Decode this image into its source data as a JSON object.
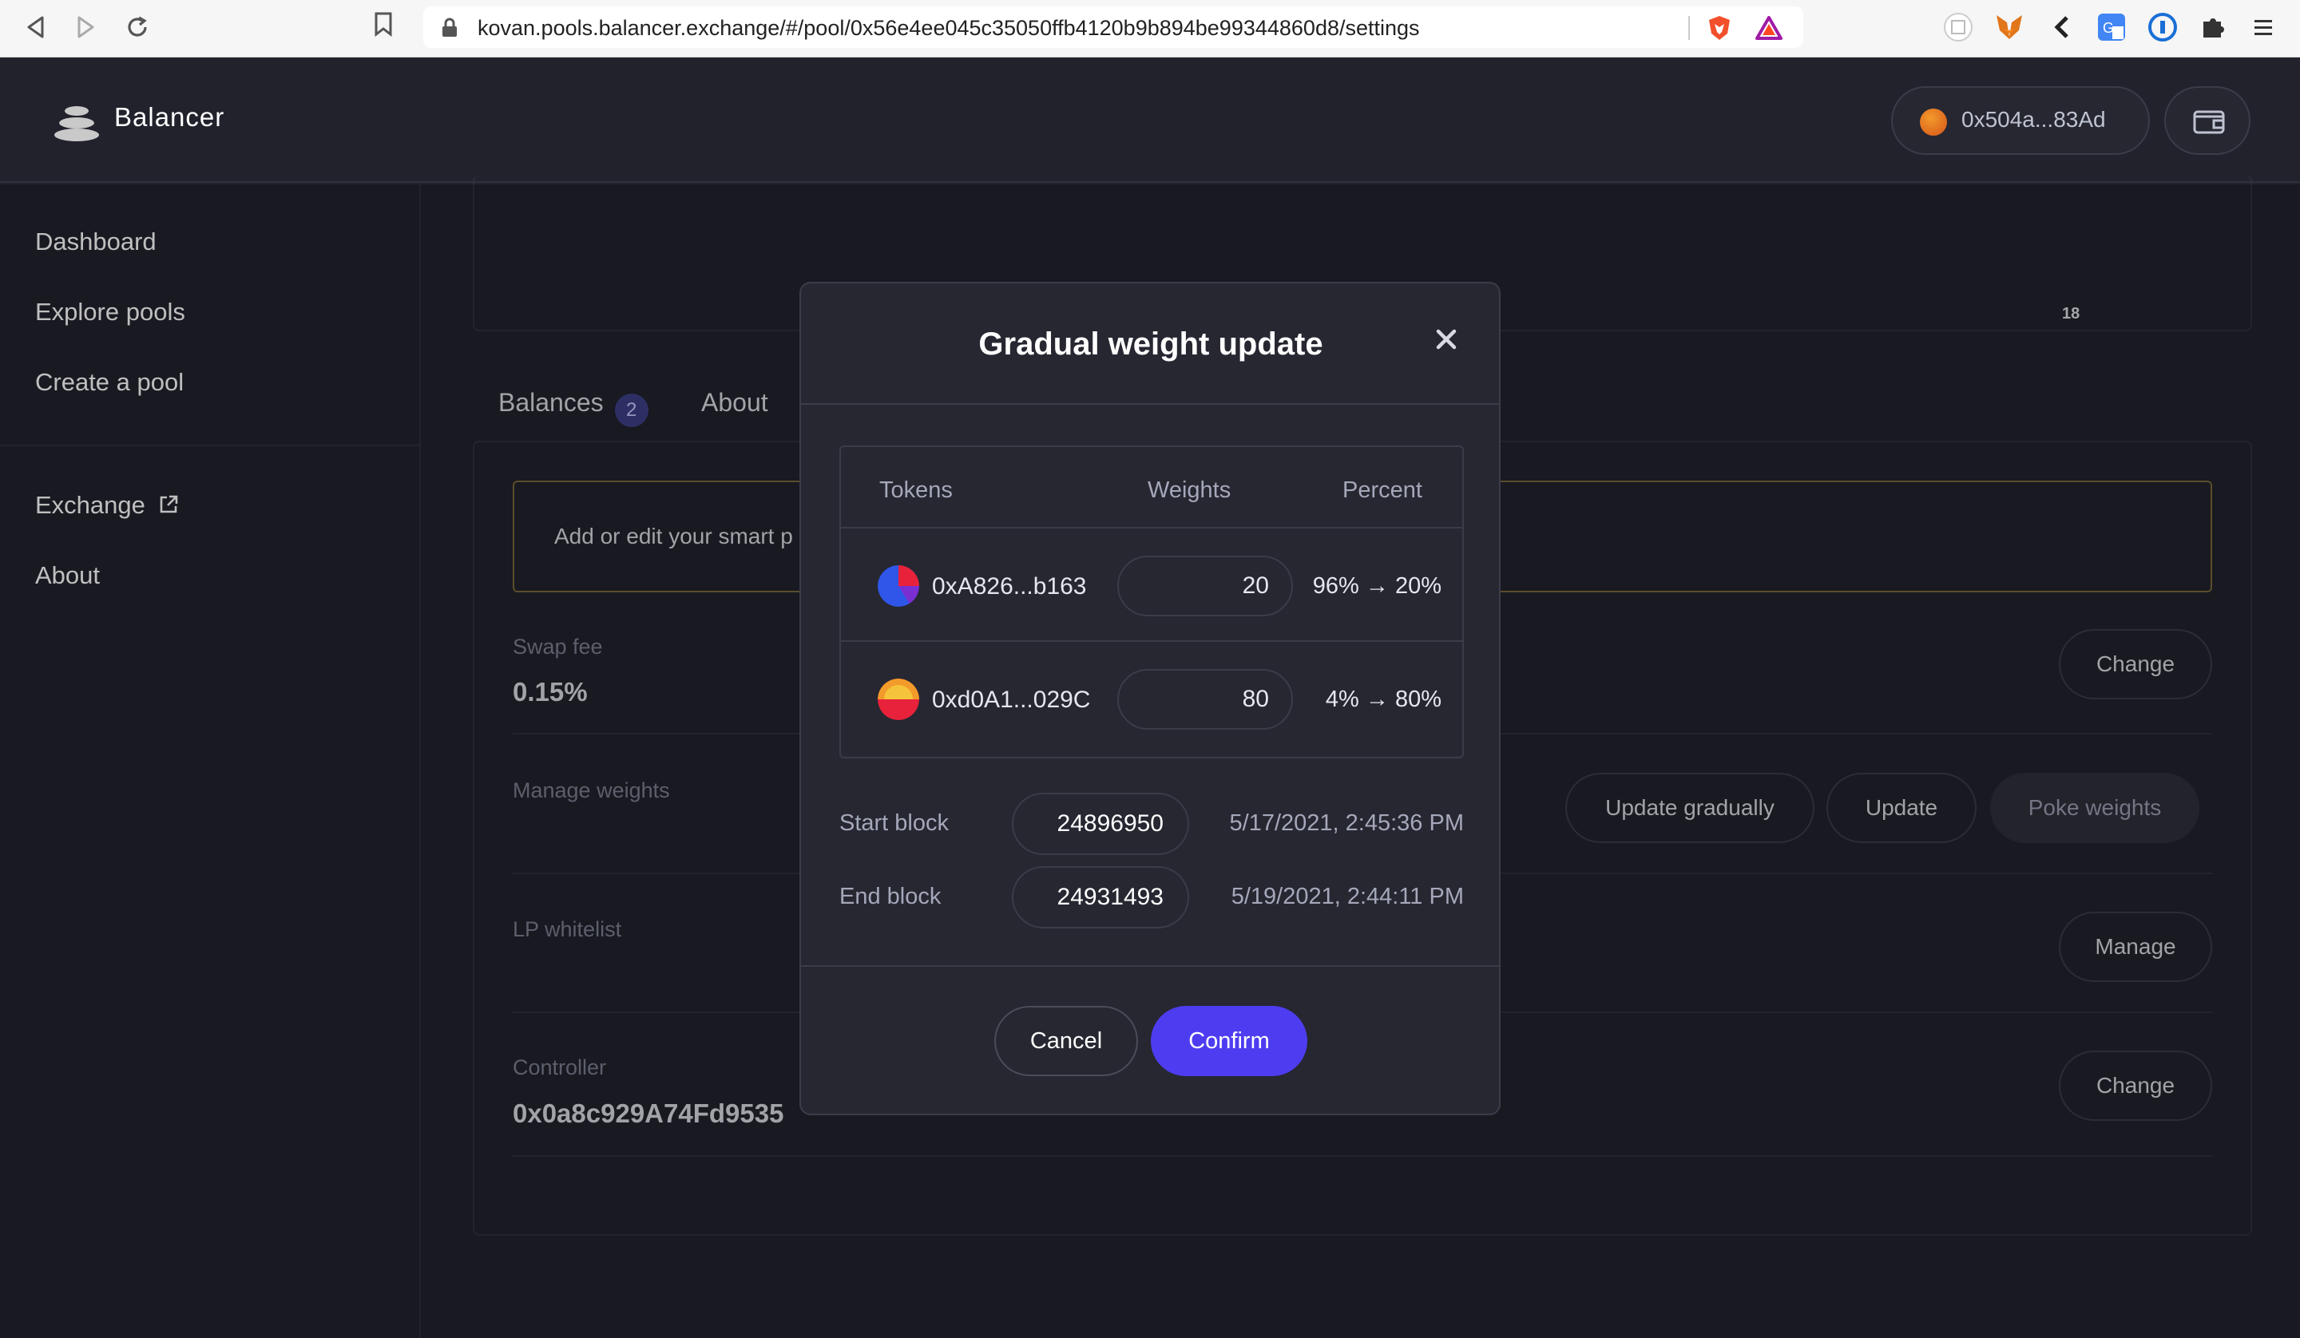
{
  "browser": {
    "url": "kovan.pools.balancer.exchange/#/pool/0x56e4ee045c35050ffb4120b9b894be99344860d8/settings"
  },
  "header": {
    "brand": "Balancer",
    "account": "0x504a...83Ad"
  },
  "sidebar": {
    "items": [
      {
        "label": "Dashboard"
      },
      {
        "label": "Explore pools"
      },
      {
        "label": "Create a pool"
      },
      {
        "label": "Exchange"
      },
      {
        "label": "About"
      }
    ]
  },
  "chart": {
    "tick": "18"
  },
  "tabs": {
    "balances": "Balances",
    "balances_count": "2",
    "about": "About"
  },
  "settings": {
    "notice": "Add or edit your smart p",
    "swap_fee_label": "Swap fee",
    "swap_fee_value": "0.15%",
    "swap_fee_button": "Change",
    "manage_weights_label": "Manage weights",
    "update_gradually_button": "Update gradually",
    "update_button": "Update",
    "poke_weights_button": "Poke weights",
    "lp_whitelist_label": "LP whitelist",
    "manage_button": "Manage",
    "controller_label": "Controller",
    "controller_value": "0x0a8c929A74Fd9535",
    "controller_button": "Change"
  },
  "modal": {
    "title": "Gradual weight update",
    "columns": {
      "tokens": "Tokens",
      "weights": "Weights",
      "percent": "Percent"
    },
    "tokens": [
      {
        "name": "0xA826...b163",
        "weight": "20",
        "percent": "96% → 20%"
      },
      {
        "name": "0xd0A1...029C",
        "weight": "80",
        "percent": "4% → 80%"
      }
    ],
    "start_block_label": "Start block",
    "start_block_value": "24896950",
    "start_block_date": "5/17/2021, 2:45:36 PM",
    "end_block_label": "End block",
    "end_block_value": "24931493",
    "end_block_date": "5/19/2021, 2:44:11 PM",
    "cancel": "Cancel",
    "confirm": "Confirm"
  }
}
